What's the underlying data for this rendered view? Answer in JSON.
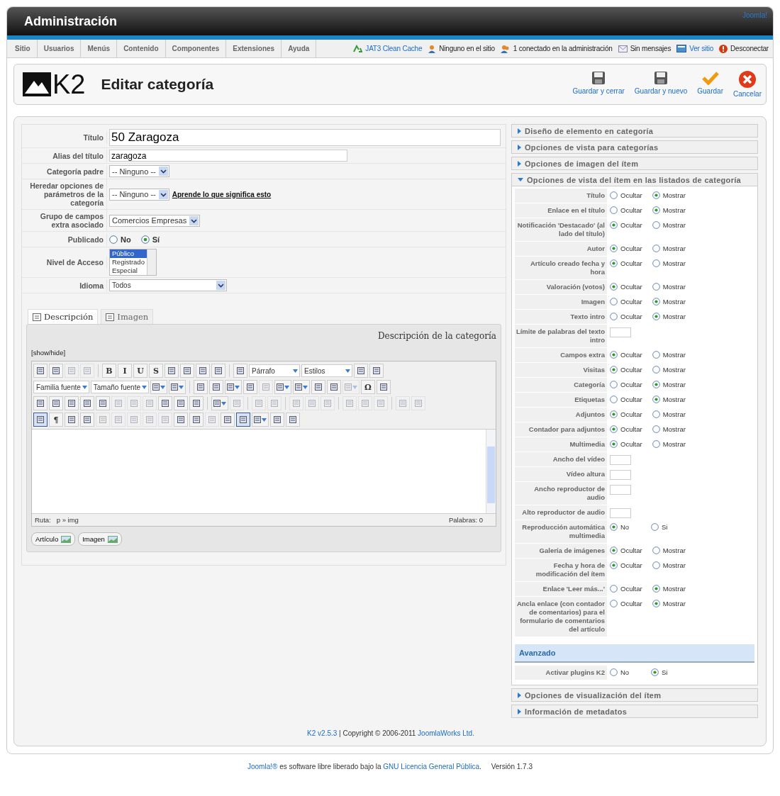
{
  "header": {
    "title": "Administración",
    "joomla_link": "Joomla!"
  },
  "menu": [
    {
      "label": "Sitio"
    },
    {
      "label": "Usuarios"
    },
    {
      "label": "Menús"
    },
    {
      "label": "Contenido"
    },
    {
      "label": "Componentes"
    },
    {
      "label": "Extensiones"
    },
    {
      "label": "Ayuda"
    }
  ],
  "status": [
    {
      "kind": "cache",
      "label": "JAT3 Clean Cache",
      "link": true
    },
    {
      "kind": "users",
      "label": "Ninguno en el sitio",
      "link": false
    },
    {
      "kind": "admins",
      "label": "1 conectado en la administración",
      "link": false
    },
    {
      "kind": "messages",
      "label": "Sin mensajes",
      "link": false
    },
    {
      "kind": "site",
      "label": "Ver sitio",
      "link": true
    },
    {
      "kind": "logout",
      "label": "Desconectar",
      "link": false
    }
  ],
  "toolbar": {
    "logo": "K2",
    "title": "Editar categoría",
    "buttons": [
      {
        "kind": "save",
        "label": "Guardar y cerrar"
      },
      {
        "kind": "save",
        "label": "Guardar y nuevo"
      },
      {
        "kind": "apply",
        "label": "Guardar"
      },
      {
        "kind": "cancel",
        "label": "Cancelar"
      }
    ]
  },
  "form": [
    {
      "label": "Título",
      "kind": "title",
      "value": "50 Zaragoza"
    },
    {
      "label": "Alias del título",
      "kind": "input",
      "value": "zaragoza"
    },
    {
      "label": "Categoría padre",
      "kind": "select",
      "value": "-- Ninguno --"
    },
    {
      "label": "Heredar opciones de parámetros de la categoría",
      "kind": "select",
      "value": "-- Ninguno --",
      "link": "Aprende lo que significa esto"
    },
    {
      "label": "Grupo de campos extra asociado",
      "kind": "select",
      "value": "Comercios Empresas"
    },
    {
      "label": "Publicado",
      "kind": "radio",
      "options": [
        {
          "label": "No",
          "selected": false
        },
        {
          "label": "Sí",
          "selected": true
        }
      ]
    },
    {
      "label": "Nivel de Acceso",
      "kind": "listbox",
      "options": [
        {
          "label": "Público",
          "selected": true
        },
        {
          "label": "Registrado",
          "selected": false
        },
        {
          "label": "Especial",
          "selected": false
        }
      ]
    },
    {
      "label": "Idioma",
      "kind": "wide",
      "value": "Todos"
    }
  ],
  "tabs": [
    {
      "label": "Descripción",
      "selected": true
    },
    {
      "label": "Imagen",
      "selected": false
    }
  ],
  "editor": {
    "heading": "Descripción de la categoría",
    "toggle": "[show/hide]",
    "toolbar_rows": [
      {
        "items": [
          {
            "kind": "icon"
          },
          {
            "kind": "icon"
          },
          {
            "kind": "icon",
            "disabled": true
          },
          {
            "kind": "icon",
            "disabled": true
          },
          {
            "kind": "sep"
          },
          {
            "kind": "glyph",
            "label": "B"
          },
          {
            "kind": "glyph",
            "label": "I"
          },
          {
            "kind": "glyph",
            "label": "U"
          },
          {
            "kind": "glyph",
            "label": "S"
          },
          {
            "kind": "icon"
          },
          {
            "kind": "icon"
          },
          {
            "kind": "icon"
          },
          {
            "kind": "icon"
          },
          {
            "kind": "sep"
          },
          {
            "kind": "icon"
          },
          {
            "kind": "select",
            "label": "Párrafo"
          },
          {
            "kind": "select",
            "label": "Estilos"
          },
          {
            "kind": "icon"
          },
          {
            "kind": "icon"
          }
        ]
      },
      {
        "items": [
          {
            "kind": "select",
            "label": "Familia fuente"
          },
          {
            "kind": "select",
            "label": "Tamaño fuente"
          },
          {
            "kind": "split"
          },
          {
            "kind": "split"
          },
          {
            "kind": "sep"
          },
          {
            "kind": "icon"
          },
          {
            "kind": "icon"
          },
          {
            "kind": "split"
          },
          {
            "kind": "icon"
          },
          {
            "kind": "icon",
            "disabled": true
          },
          {
            "kind": "split"
          },
          {
            "kind": "split"
          },
          {
            "kind": "icon"
          },
          {
            "kind": "icon"
          },
          {
            "kind": "split",
            "disabled": true
          },
          {
            "kind": "glyph",
            "label": "Ω"
          },
          {
            "kind": "icon"
          }
        ]
      },
      {
        "items": [
          {
            "kind": "icon"
          },
          {
            "kind": "icon"
          },
          {
            "kind": "icon"
          },
          {
            "kind": "icon"
          },
          {
            "kind": "icon"
          },
          {
            "kind": "icon",
            "disabled": true
          },
          {
            "kind": "icon",
            "disabled": true
          },
          {
            "kind": "icon",
            "disabled": true
          },
          {
            "kind": "icon"
          },
          {
            "kind": "icon"
          },
          {
            "kind": "icon"
          },
          {
            "kind": "sep"
          },
          {
            "kind": "split"
          },
          {
            "kind": "icon",
            "disabled": true
          },
          {
            "kind": "sep"
          },
          {
            "kind": "icon",
            "disabled": true
          },
          {
            "kind": "icon",
            "disabled": true
          },
          {
            "kind": "sep"
          },
          {
            "kind": "icon",
            "disabled": true
          },
          {
            "kind": "icon",
            "disabled": true
          },
          {
            "kind": "icon",
            "disabled": true
          },
          {
            "kind": "sep"
          },
          {
            "kind": "icon",
            "disabled": true
          },
          {
            "kind": "icon",
            "disabled": true
          },
          {
            "kind": "icon",
            "disabled": true
          },
          {
            "kind": "sep"
          },
          {
            "kind": "icon",
            "disabled": true
          },
          {
            "kind": "icon",
            "disabled": true
          }
        ]
      },
      {
        "items": [
          {
            "kind": "icon",
            "pressed": true
          },
          {
            "kind": "glyph",
            "label": "¶"
          },
          {
            "kind": "icon"
          },
          {
            "kind": "icon"
          },
          {
            "kind": "icon",
            "disabled": true
          },
          {
            "kind": "icon",
            "disabled": true
          },
          {
            "kind": "icon",
            "disabled": true
          },
          {
            "kind": "icon",
            "disabled": true
          },
          {
            "kind": "icon",
            "disabled": true
          },
          {
            "kind": "icon"
          },
          {
            "kind": "icon"
          },
          {
            "kind": "icon",
            "disabled": true
          },
          {
            "kind": "icon"
          },
          {
            "kind": "icon",
            "pressed": true
          },
          {
            "kind": "split"
          },
          {
            "kind": "icon"
          },
          {
            "kind": "icon"
          }
        ]
      }
    ],
    "path_label": "Ruta:",
    "path": "p » img",
    "words": "Palabras: 0",
    "buttons": [
      {
        "label": "Artículo"
      },
      {
        "label": "Imagen"
      }
    ]
  },
  "sections": [
    {
      "title": "Diseño de elemento en categoría",
      "expanded": false
    },
    {
      "title": "Opciones de vista para categorías",
      "expanded": false
    },
    {
      "title": "Opciones de imagen del ítem",
      "expanded": false
    },
    {
      "title": "Opciones de vista del ítem en las listados de categoría",
      "expanded": true,
      "rows": [
        {
          "label": "Título",
          "kind": "radio",
          "options": [
            {
              "label": "Ocultar",
              "selected": false
            },
            {
              "label": "Mostrar",
              "selected": true
            }
          ]
        },
        {
          "label": "Enlace en el título",
          "kind": "radio",
          "options": [
            {
              "label": "Ocultar",
              "selected": false
            },
            {
              "label": "Mostrar",
              "selected": true
            }
          ]
        },
        {
          "label": "Notificación 'Destacado' (al lado del título)",
          "kind": "radio",
          "options": [
            {
              "label": "Ocultar",
              "selected": true
            },
            {
              "label": "Mostrar",
              "selected": false
            }
          ]
        },
        {
          "label": "Autor",
          "kind": "radio",
          "options": [
            {
              "label": "Ocultar",
              "selected": true
            },
            {
              "label": "Mostrar",
              "selected": false
            }
          ]
        },
        {
          "label": "Artículo creado fecha y hora",
          "kind": "radio",
          "options": [
            {
              "label": "Ocultar",
              "selected": true
            },
            {
              "label": "Mostrar",
              "selected": false
            }
          ]
        },
        {
          "label": "Valoración (votos)",
          "kind": "radio",
          "options": [
            {
              "label": "Ocultar",
              "selected": true
            },
            {
              "label": "Mostrar",
              "selected": false
            }
          ]
        },
        {
          "label": "Imagen",
          "kind": "radio",
          "options": [
            {
              "label": "Ocultar",
              "selected": false
            },
            {
              "label": "Mostrar",
              "selected": true
            }
          ]
        },
        {
          "label": "Texto intro",
          "kind": "radio",
          "options": [
            {
              "label": "Ocultar",
              "selected": false
            },
            {
              "label": "Mostrar",
              "selected": true
            }
          ]
        },
        {
          "label": "Límite de palabras del texto intro",
          "kind": "input"
        },
        {
          "label": "Campos extra",
          "kind": "radio",
          "options": [
            {
              "label": "Ocultar",
              "selected": true
            },
            {
              "label": "Mostrar",
              "selected": false
            }
          ]
        },
        {
          "label": "Visitas",
          "kind": "radio",
          "options": [
            {
              "label": "Ocultar",
              "selected": true
            },
            {
              "label": "Mostrar",
              "selected": false
            }
          ]
        },
        {
          "label": "Categoría",
          "kind": "radio",
          "options": [
            {
              "label": "Ocultar",
              "selected": false
            },
            {
              "label": "Mostrar",
              "selected": true
            }
          ]
        },
        {
          "label": "Etiquetas",
          "kind": "radio",
          "options": [
            {
              "label": "Ocultar",
              "selected": false
            },
            {
              "label": "Mostrar",
              "selected": true
            }
          ]
        },
        {
          "label": "Adjuntos",
          "kind": "radio",
          "options": [
            {
              "label": "Ocultar",
              "selected": true
            },
            {
              "label": "Mostrar",
              "selected": false
            }
          ]
        },
        {
          "label": "Contador para adjuntos",
          "kind": "radio",
          "options": [
            {
              "label": "Ocultar",
              "selected": true
            },
            {
              "label": "Mostrar",
              "selected": false
            }
          ]
        },
        {
          "label": "Multimedia",
          "kind": "radio",
          "options": [
            {
              "label": "Ocultar",
              "selected": true
            },
            {
              "label": "Mostrar",
              "selected": false
            }
          ]
        },
        {
          "label": "Ancho del vídeo",
          "kind": "input"
        },
        {
          "label": "Vídeo altura",
          "kind": "input"
        },
        {
          "label": "Ancho reproductor de audio",
          "kind": "input"
        },
        {
          "label": "Alto reproductor de audio",
          "kind": "input"
        },
        {
          "label": "Reproducción automática multimedia",
          "kind": "radio",
          "options": [
            {
              "label": "No",
              "selected": true
            },
            {
              "label": "Si",
              "selected": false
            }
          ]
        },
        {
          "label": "Galería de imágenes",
          "kind": "radio",
          "options": [
            {
              "label": "Ocultar",
              "selected": true
            },
            {
              "label": "Mostrar",
              "selected": false
            }
          ]
        },
        {
          "label": "Fecha y hora de modificación del ítem",
          "kind": "radio",
          "options": [
            {
              "label": "Ocultar",
              "selected": true
            },
            {
              "label": "Mostrar",
              "selected": false
            }
          ]
        },
        {
          "label": "Enlace 'Leer más...'",
          "kind": "radio",
          "options": [
            {
              "label": "Ocultar",
              "selected": false
            },
            {
              "label": "Mostrar",
              "selected": true
            }
          ]
        },
        {
          "label": "Ancla enlace (con contador de comentarios) para el formulario de comentarios del artículo",
          "kind": "radio",
          "options": [
            {
              "label": "Ocultar",
              "selected": false
            },
            {
              "label": "Mostrar",
              "selected": true
            }
          ]
        }
      ],
      "advanced": {
        "title": "Avanzado",
        "rows": [
          {
            "label": "Activar plugins K2",
            "kind": "radio",
            "options": [
              {
                "label": "No",
                "selected": false
              },
              {
                "label": "Si",
                "selected": true
              }
            ]
          }
        ]
      }
    },
    {
      "title": "Opciones de visualización del ítem",
      "expanded": false
    },
    {
      "title": "Información de metadatos",
      "expanded": false
    }
  ],
  "copyright": {
    "version_link": "K2 v2.5.3",
    "text": " | Copyright © 2006-2011 ",
    "company_link": "JoomlaWorks Ltd."
  },
  "footer": {
    "joomla_link": "Joomla!®",
    "text": " es software libre liberado bajo la ",
    "license_link": "GNU Licencia General Pública",
    "after": ".     Versión 1.7.3"
  }
}
